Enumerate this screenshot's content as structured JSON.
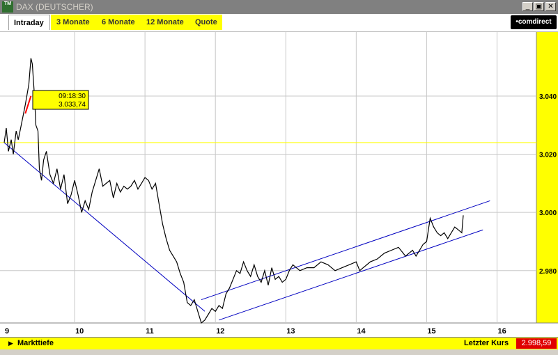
{
  "window": {
    "title": "DAX (DEUTSCHER)",
    "icon_label": "TM",
    "buttons": [
      "_",
      "▣",
      "✕"
    ]
  },
  "tabs": [
    {
      "label": "Intraday",
      "active": true
    },
    {
      "label": "3 Monate",
      "active": false
    },
    {
      "label": "6 Monate",
      "active": false
    },
    {
      "label": "12 Monate",
      "active": false
    },
    {
      "label": "Quote",
      "active": false
    }
  ],
  "brand": "•comdirect",
  "statusbar": {
    "left_label": "Markttiefe",
    "right_label": "Letzter Kurs",
    "last_price": "2.998,59"
  },
  "colors": {
    "accent_yellow": "#ffff00",
    "trend_lines": "#0000c0",
    "price_line": "#000000",
    "price_marker": "#ff0000",
    "last_price_bg": "#e00000",
    "reference_line": "#ffff00"
  },
  "chart_data": {
    "type": "line",
    "x_ticks": [
      "9",
      "10",
      "11",
      "12",
      "13",
      "14",
      "15",
      "16"
    ],
    "y_ticks": [
      "3.040",
      "3.020",
      "3.000",
      "2.980"
    ],
    "xlim": [
      9,
      16.5
    ],
    "ylim": [
      2962,
      3062
    ],
    "grid": true,
    "reference_level": 3024,
    "tooltip": {
      "time": "09:18:30",
      "value": "3.033,74"
    },
    "series": [
      {
        "x": [
          9.0,
          9.03,
          9.06,
          9.1,
          9.13,
          9.17,
          9.2,
          9.25,
          9.3,
          9.35,
          9.38,
          9.4,
          9.43,
          9.45,
          9.48,
          9.5,
          9.53,
          9.56,
          9.6,
          9.65,
          9.7,
          9.75,
          9.8,
          9.85,
          9.9,
          9.95,
          10.0,
          10.05,
          10.1,
          10.15,
          10.2,
          10.25,
          10.3,
          10.35,
          10.4,
          10.45,
          10.5,
          10.55,
          10.6,
          10.65,
          10.7,
          10.75,
          10.8,
          10.85,
          10.9,
          10.95,
          11.0,
          11.05,
          11.1,
          11.15,
          11.2,
          11.25,
          11.3,
          11.35,
          11.4,
          11.45,
          11.5,
          11.55,
          11.6,
          11.65,
          11.7,
          11.75,
          11.8,
          11.85,
          11.9,
          11.95,
          12.0,
          12.05,
          12.1,
          12.15,
          12.2,
          12.25,
          12.3,
          12.35,
          12.4,
          12.45,
          12.5,
          12.55,
          12.6,
          12.65,
          12.7,
          12.75,
          12.8,
          12.85,
          12.9,
          12.95,
          13.0,
          13.05,
          13.1,
          13.15,
          13.2,
          13.3,
          13.4,
          13.5,
          13.6,
          13.7,
          13.8,
          13.9,
          14.0,
          14.05,
          14.1,
          14.15,
          14.2,
          14.3,
          14.4,
          14.5,
          14.6,
          14.7,
          14.8,
          14.85,
          14.9,
          14.95,
          15.0,
          15.05,
          15.1,
          15.15,
          15.2,
          15.25,
          15.3,
          15.35,
          15.4,
          15.45,
          15.5,
          15.52
        ],
        "y": [
          3024,
          3029,
          3021,
          3025,
          3020,
          3028,
          3025,
          3031,
          3037,
          3044,
          3053,
          3051,
          3040,
          3030,
          3028,
          3015,
          3011,
          3018,
          3021,
          3013,
          3010,
          3015,
          3008,
          3013,
          3003,
          3006,
          3011,
          3006,
          3000,
          3004,
          3001,
          3007,
          3011,
          3015,
          3009,
          3010,
          3011,
          3005,
          3010,
          3007,
          3009,
          3008,
          3009,
          3011,
          3008,
          3010,
          3012,
          3011,
          3008,
          3010,
          3003,
          2996,
          2991,
          2987,
          2985,
          2983,
          2979,
          2976,
          2969,
          2968,
          2970,
          2966,
          2962,
          2963,
          2965,
          2967,
          2966,
          2968,
          2967,
          2972,
          2974,
          2977,
          2980,
          2979,
          2983,
          2980,
          2978,
          2982,
          2978,
          2976,
          2980,
          2975,
          2981,
          2977,
          2978,
          2976,
          2977,
          2980,
          2982,
          2981,
          2980,
          2981,
          2981,
          2983,
          2982,
          2980,
          2981,
          2982,
          2983,
          2980,
          2981,
          2982,
          2983,
          2984,
          2986,
          2987,
          2988,
          2985,
          2987,
          2985,
          2987,
          2989,
          2990,
          2998,
          2995,
          2993,
          2992,
          2993,
          2991,
          2993,
          2995,
          2994,
          2993,
          2999
        ]
      }
    ],
    "trend_lines": [
      {
        "x": [
          9.0,
          11.85
        ],
        "y": [
          3024,
          2966
        ]
      },
      {
        "x": [
          11.8,
          15.9
        ],
        "y": [
          2970,
          3004
        ]
      },
      {
        "x": [
          12.05,
          15.8
        ],
        "y": [
          2963,
          2994
        ]
      }
    ]
  }
}
